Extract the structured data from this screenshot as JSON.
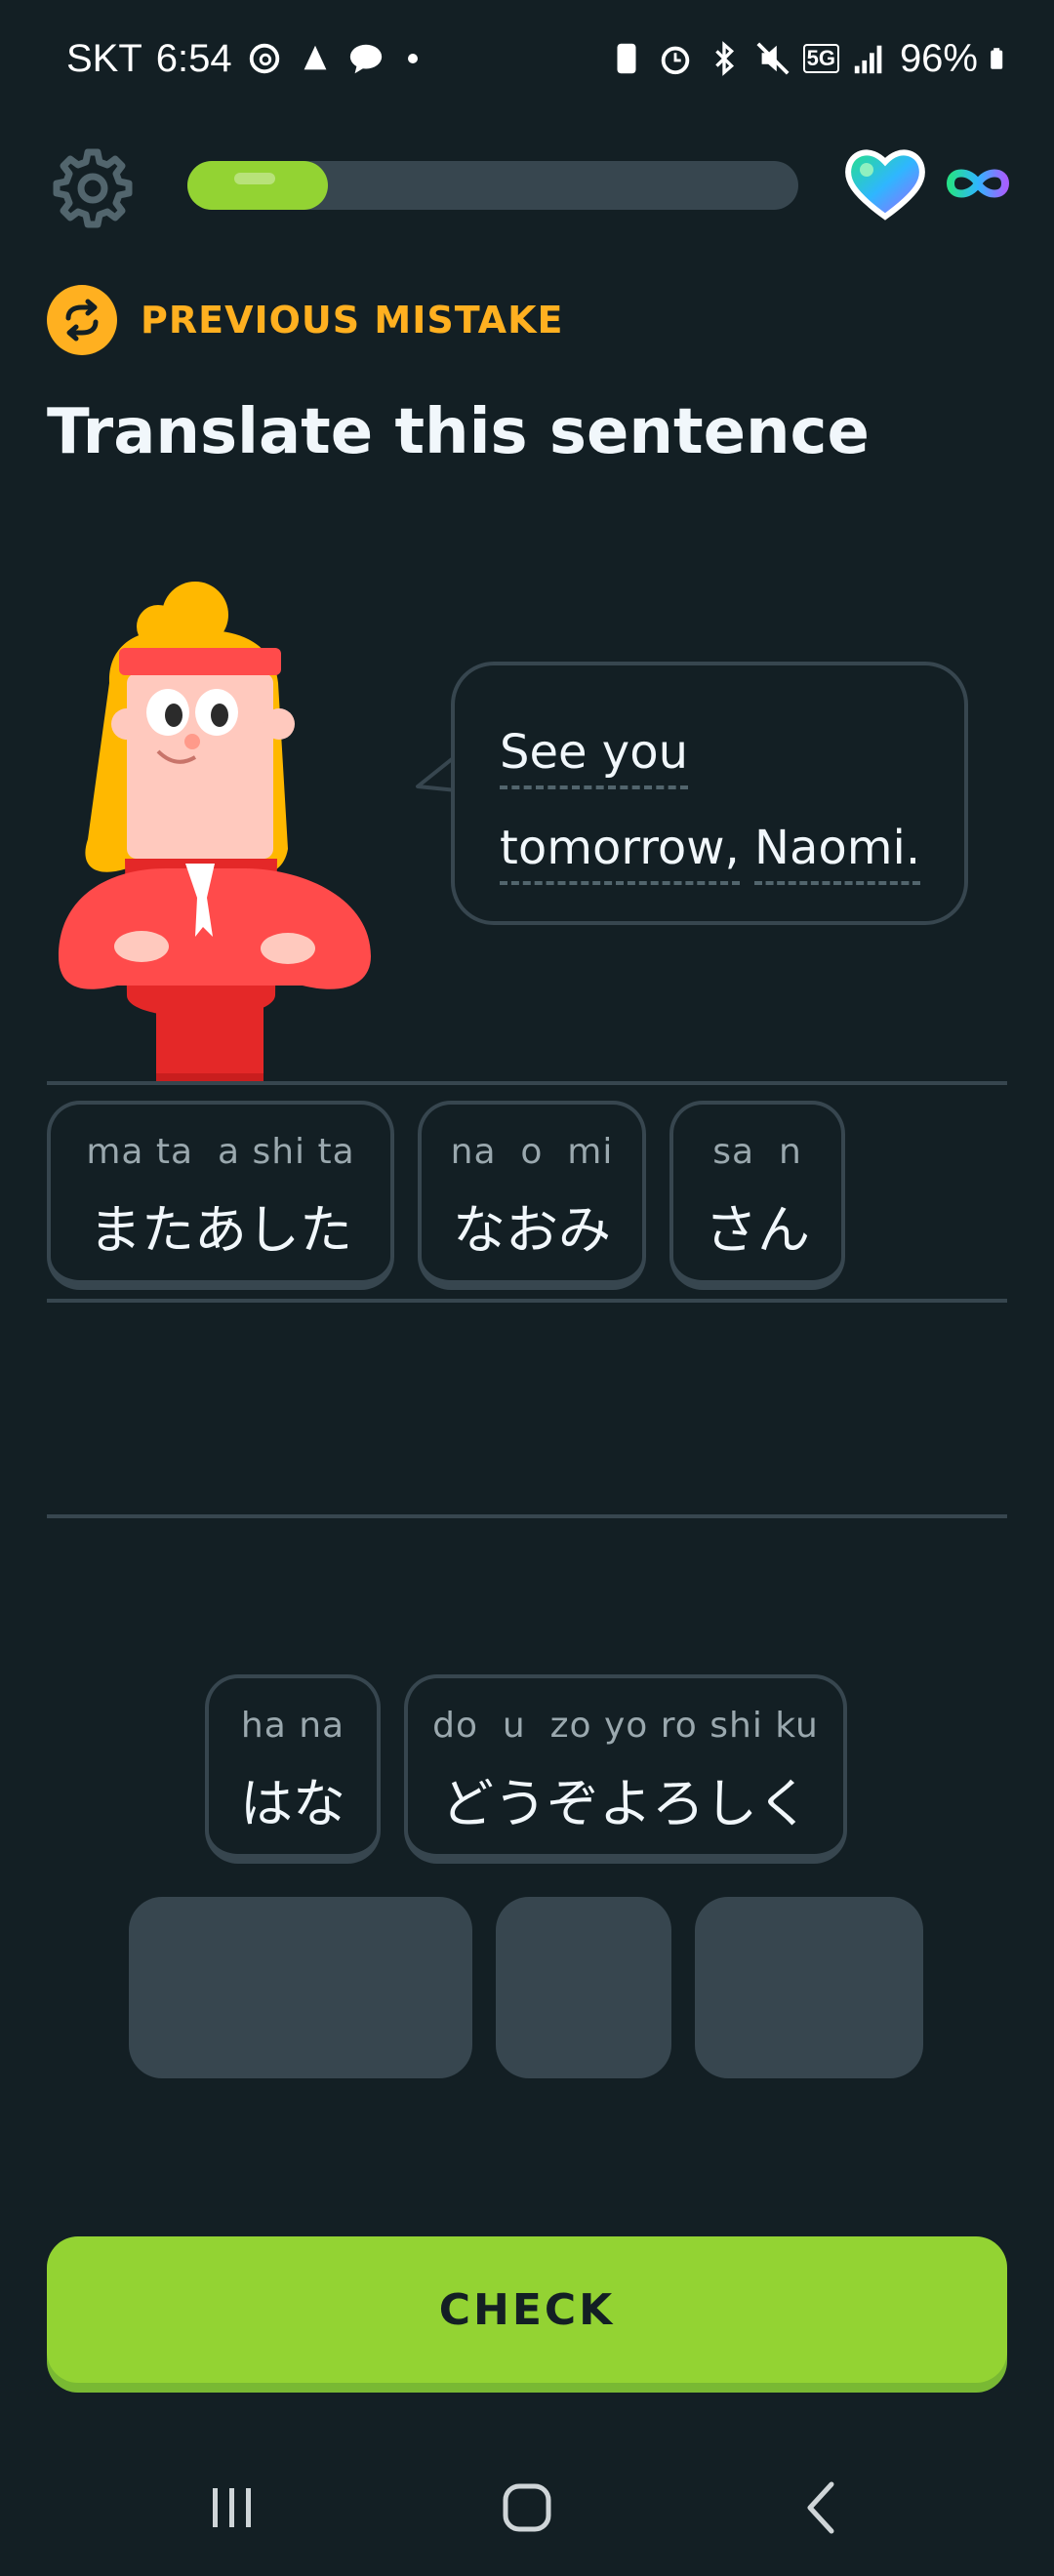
{
  "status_bar": {
    "carrier": "SKT",
    "time": "6:54",
    "battery": "96%",
    "network": "5G"
  },
  "top_bar": {
    "progress": 0.23,
    "hearts": "infinite"
  },
  "prompt": {
    "tag": "PREVIOUS MISTAKE",
    "title": "Translate this sentence"
  },
  "bubble": {
    "line1": "See you",
    "line2_word1": "tomorrow,",
    "line2_word2": "Naomi."
  },
  "answer_tiles": [
    {
      "romaji": "ma ta  a shi ta",
      "kana": "またあした"
    },
    {
      "romaji": "na  o  mi",
      "kana": "なおみ"
    },
    {
      "romaji": "sa  n",
      "kana": "さん"
    }
  ],
  "bank_tiles": [
    {
      "romaji": "ha na",
      "kana": "はな"
    },
    {
      "romaji": "do  u  zo yo ro shi ku",
      "kana": "どうぞよろしく"
    }
  ],
  "check_button": "CHECK",
  "colors": {
    "background": "#131f24",
    "accent_green": "#93d333",
    "mistake_orange": "#ffb020",
    "tile_border": "#37464f"
  }
}
